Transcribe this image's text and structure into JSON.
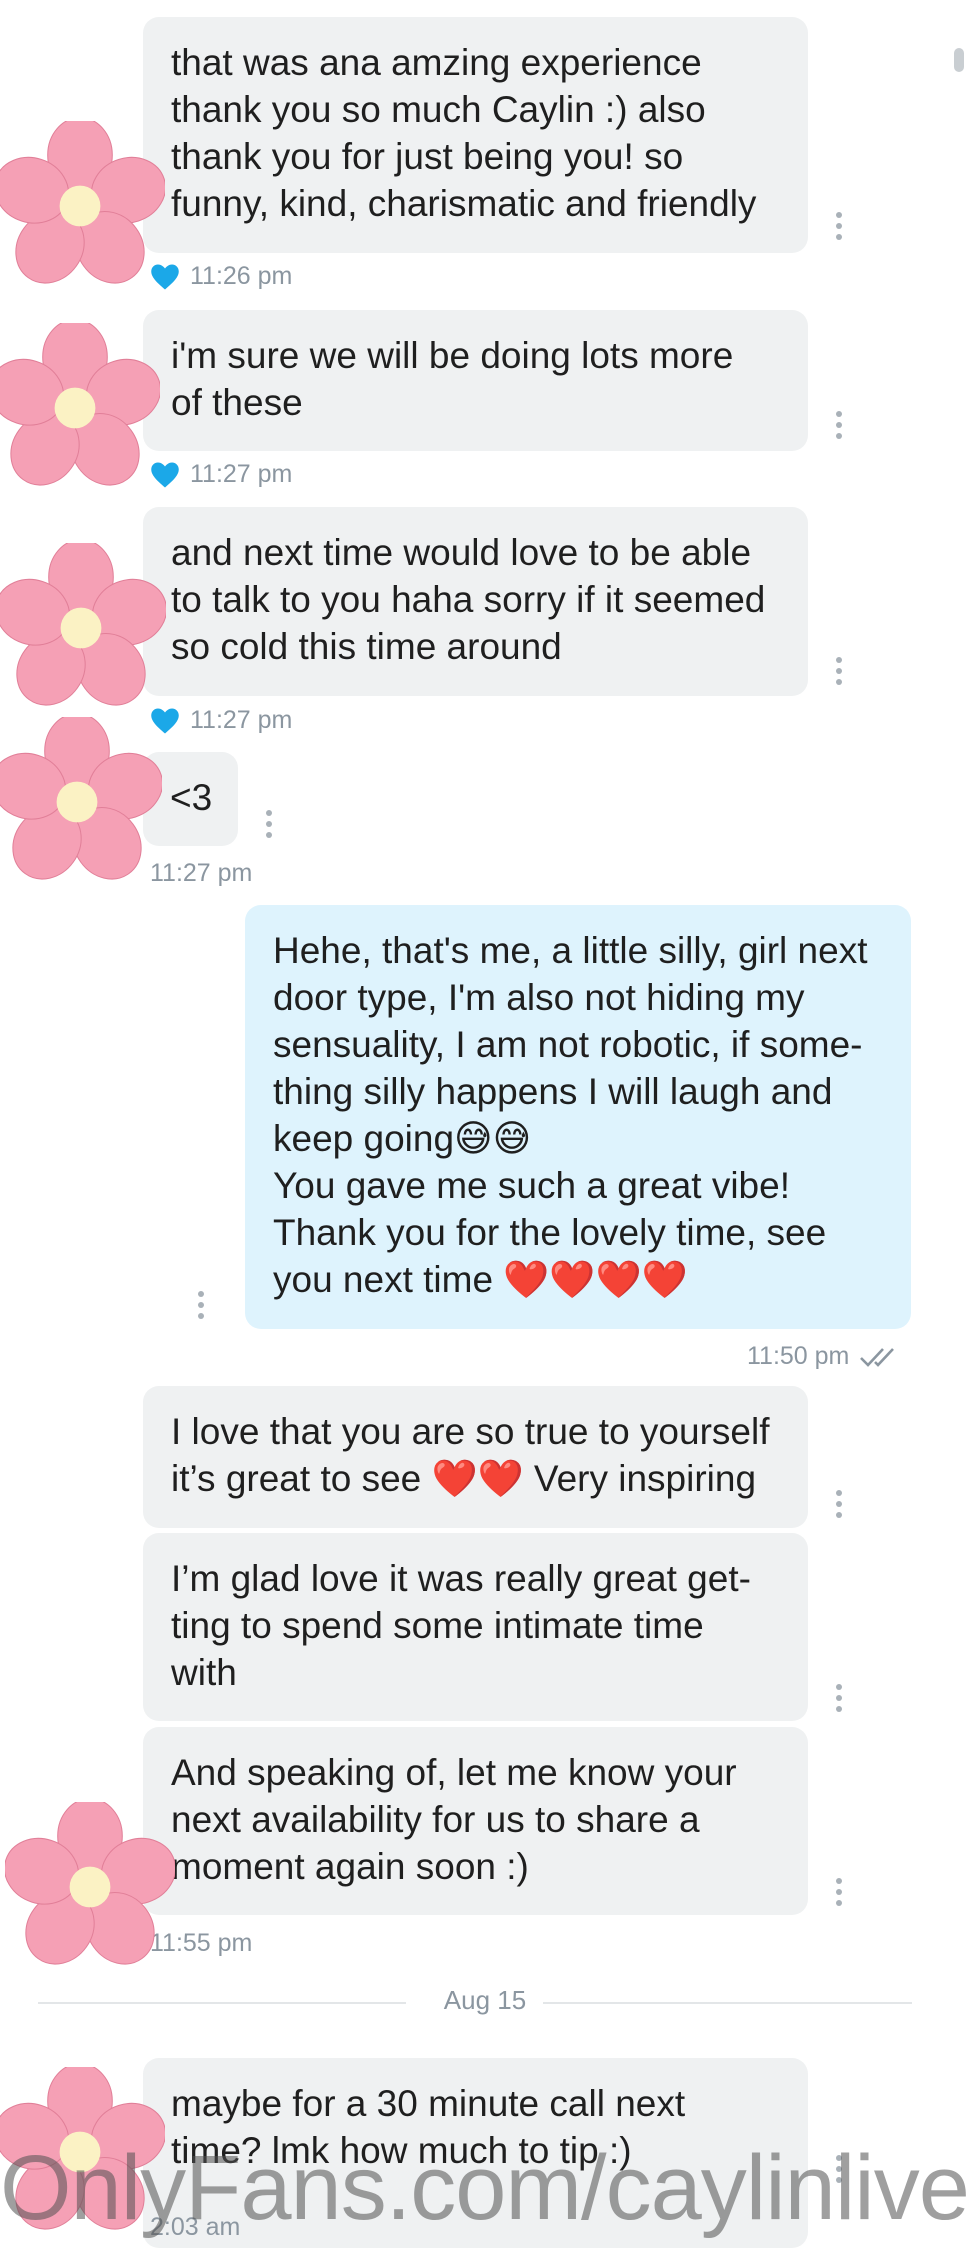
{
  "messages": [
    {
      "text": "that was ana amzing experience\nthank you so much Caylin :) also\nthank you for just being you! so\nfunny, kind, charismatic and friendly",
      "time": "11:26 pm"
    },
    {
      "text": "i'm sure we will be doing lots more\nof these",
      "time": "11:27 pm"
    },
    {
      "text": "and next time would love to be able\nto talk to you haha sorry if it seemed\nso cold this time around",
      "time": "11:27 pm"
    },
    {
      "text": "<3",
      "time": "11:27 pm"
    },
    {
      "text": "Hehe, that's me, a little silly, girl next\ndoor type, I'm also not hiding my\nsensuality, I am not robotic, if some-\nthing silly happens I will laugh and\nkeep going😅😅\nYou gave me such a great vibe!\nThank you for the lovely time, see\nyou next time ❤️❤️❤️❤️",
      "time": "11:50 pm"
    },
    {
      "text": "I love that you are so true to yourself\nit’s great to see ❤️❤️ Very inspiring"
    },
    {
      "text": "I’m glad love it was really great get-\nting to spend some intimate time\nwith"
    },
    {
      "text": "And speaking of, let me know your\nnext availability for us to share a\nmoment again soon :)",
      "time": "11:55 pm"
    },
    {
      "text": "maybe for a 30 minute call next\ntime? lmk how much to tip :)",
      "time": "2:03 am"
    }
  ],
  "date_separator": "Aug 15",
  "watermark": "OnlyFans.com/caylinlive",
  "icons": {
    "reaction": "heart-icon",
    "read": "double-check-icon",
    "menu": "more-vertical-icon",
    "avatar": "flower-avatar-icon"
  },
  "colors": {
    "incoming_bubble": "#eff1f2",
    "outgoing_bubble": "#def3fd",
    "heart": "#1ba8e8",
    "flower_petal": "#f5a0b5",
    "flower_center": "#fbf2c4"
  }
}
